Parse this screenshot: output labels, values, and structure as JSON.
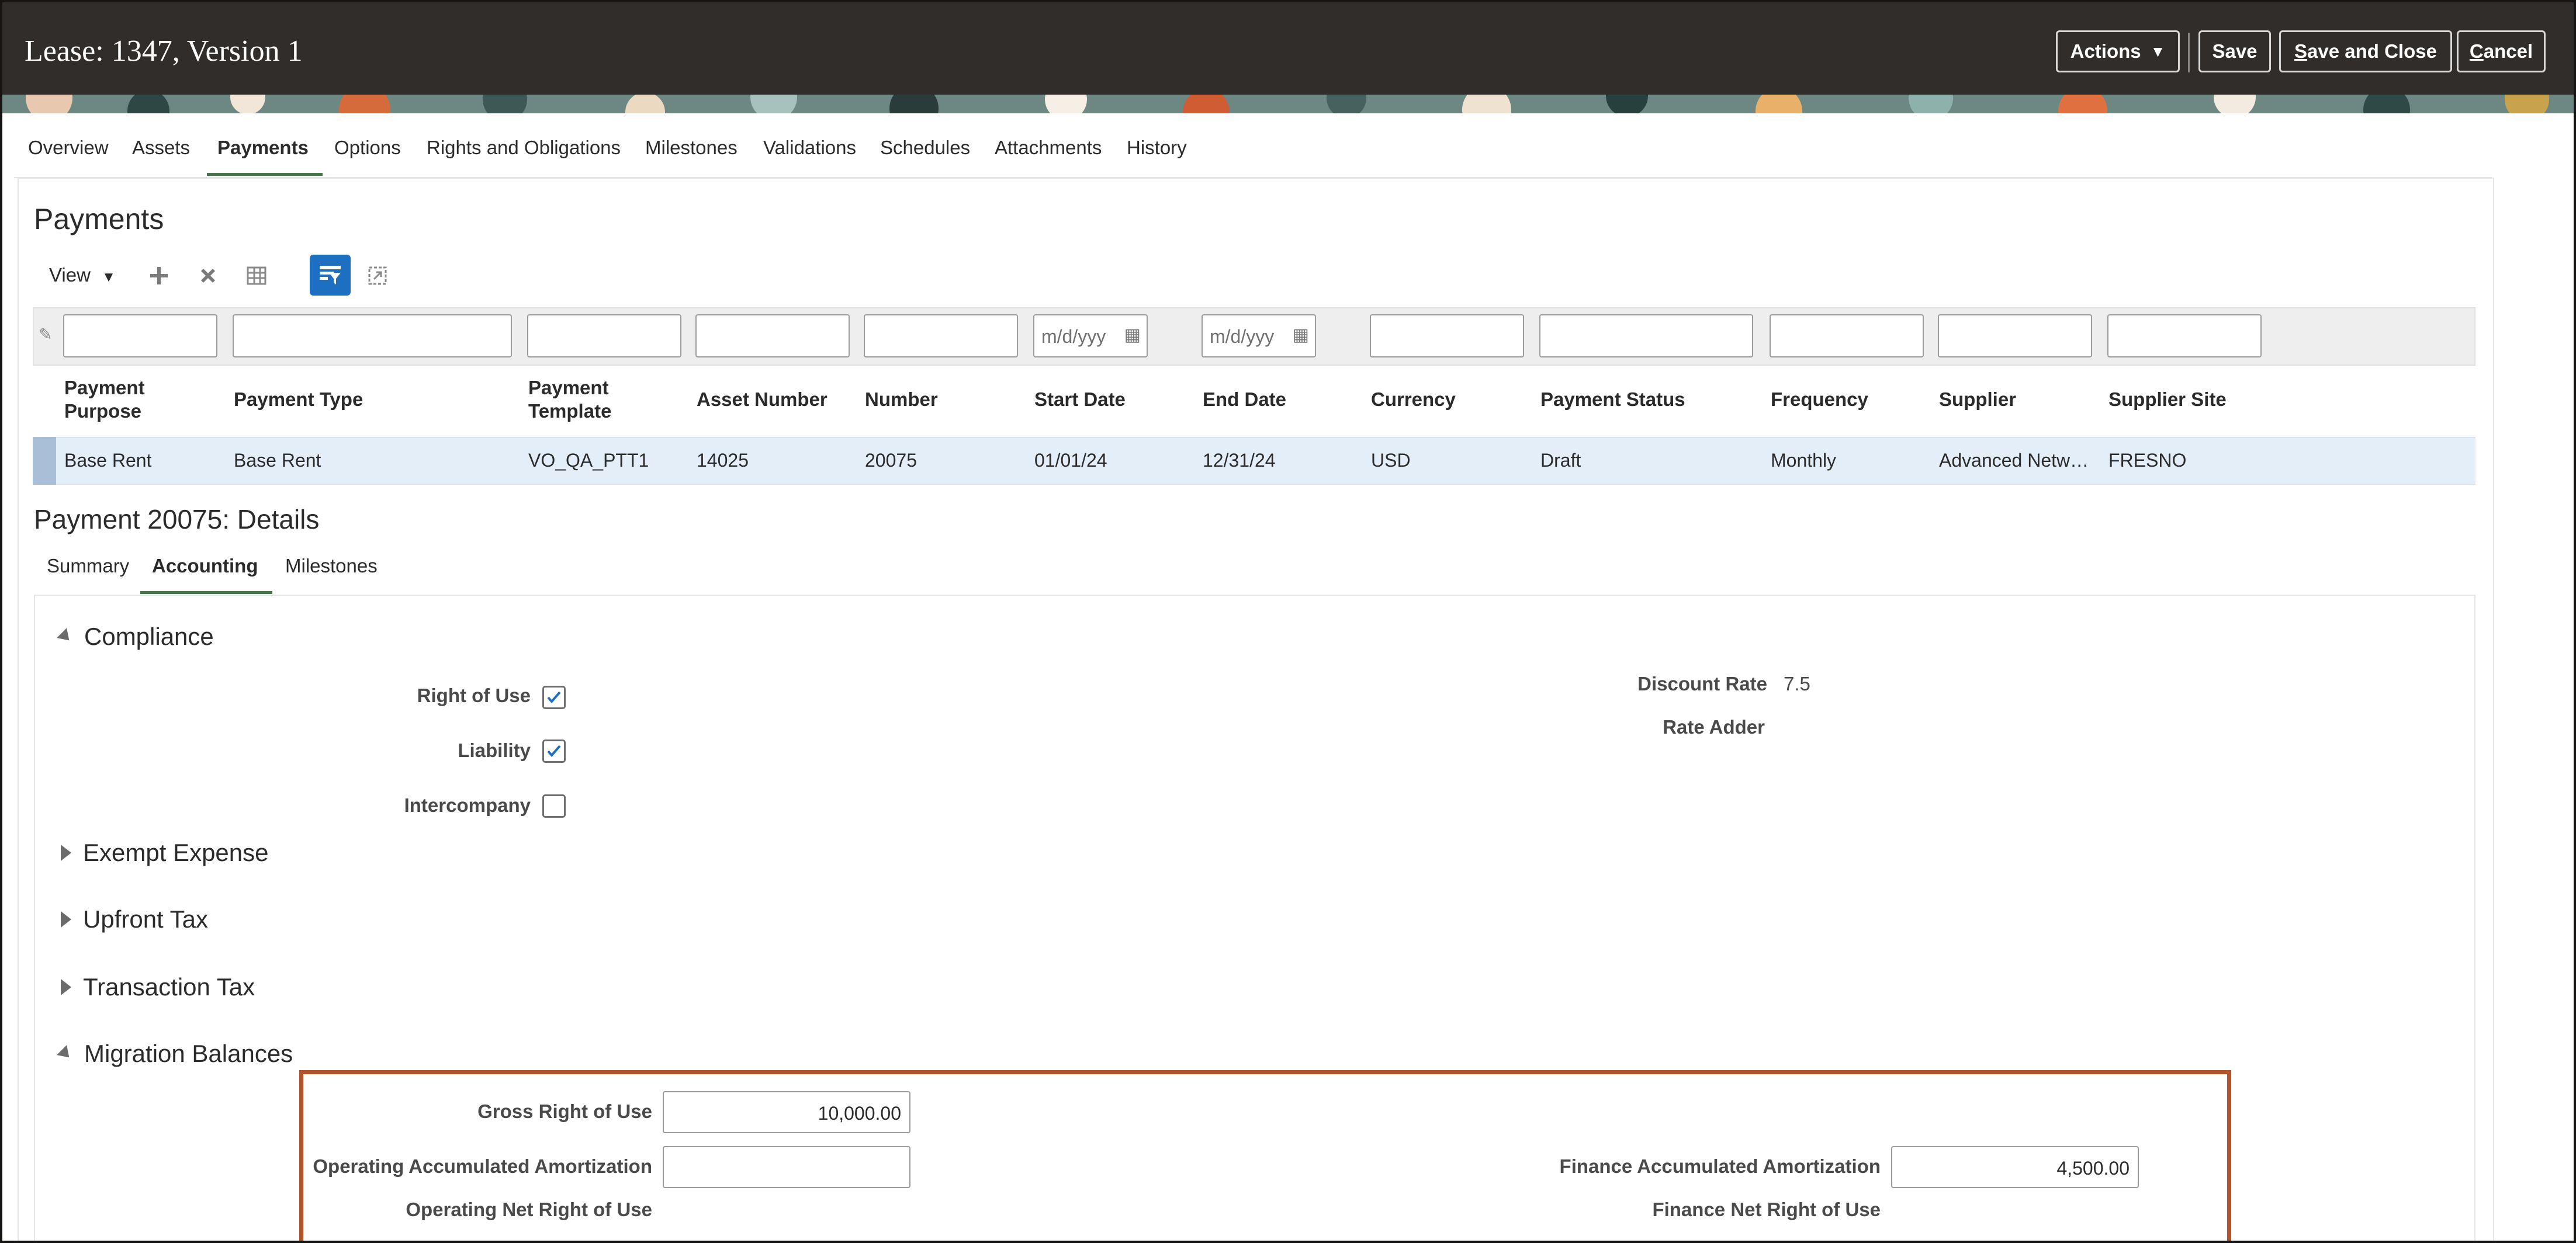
{
  "header": {
    "title": "Lease: 1347, Version 1",
    "actions_label": "Actions",
    "save_label": "Save",
    "save_close_label_first": "S",
    "save_close_label_rest": "ave and Close",
    "cancel_label_first": "C",
    "cancel_label_rest": "ancel"
  },
  "top_tabs": [
    "Overview",
    "Assets",
    "Payments",
    "Options",
    "Rights and Obligations",
    "Milestones",
    "Validations",
    "Schedules",
    "Attachments",
    "History"
  ],
  "active_top_tab": "Payments",
  "payments": {
    "heading": "Payments",
    "view_label": "View",
    "filters": {
      "date_placeholder": "m/d/yyy"
    },
    "columns": [
      "Payment Purpose",
      "Payment Type",
      "Payment Template",
      "Asset Number",
      "Number",
      "Start Date",
      "End Date",
      "Currency",
      "Payment Status",
      "Frequency",
      "Supplier",
      "Supplier Site"
    ],
    "rows": [
      {
        "payment_purpose": "Base Rent",
        "payment_type": "Base Rent",
        "payment_template": "VO_QA_PTT1",
        "asset_number": "14025",
        "number": "20075",
        "start_date": "01/01/24",
        "end_date": "12/31/24",
        "currency": "USD",
        "payment_status": "Draft",
        "frequency": "Monthly",
        "supplier": "Advanced Netw…",
        "supplier_site": "FRESNO"
      }
    ]
  },
  "details": {
    "heading": "Payment 20075: Details",
    "tabs": [
      "Summary",
      "Accounting",
      "Milestones"
    ],
    "active_tab": "Accounting",
    "sections": {
      "compliance": "Compliance",
      "exempt_expense": "Exempt Expense",
      "upfront_tax": "Upfront Tax",
      "transaction_tax": "Transaction Tax",
      "migration_balances": "Migration Balances"
    },
    "compliance": {
      "right_of_use_label": "Right of Use",
      "right_of_use_checked": true,
      "liability_label": "Liability",
      "liability_checked": true,
      "intercompany_label": "Intercompany",
      "intercompany_checked": false,
      "discount_rate_label": "Discount Rate",
      "discount_rate_value": "7.5",
      "rate_adder_label": "Rate Adder"
    },
    "migration": {
      "gross_rou_label": "Gross Right of Use",
      "gross_rou_value": "10,000.00",
      "op_acc_amort_label": "Operating Accumulated Amortization",
      "op_acc_amort_value": "",
      "op_net_rou_label": "Operating Net Right of Use",
      "fin_acc_amort_label": "Finance Accumulated Amortization",
      "fin_acc_amort_value": "4,500.00",
      "fin_net_rou_label": "Finance Net Right of Use"
    }
  },
  "colors": {
    "header_bg": "#312d2a",
    "accent_green": "#467649",
    "selected_row": "#e3eef8",
    "highlight_border": "#b2532b",
    "checkbox_blue": "#1d6fc2"
  }
}
